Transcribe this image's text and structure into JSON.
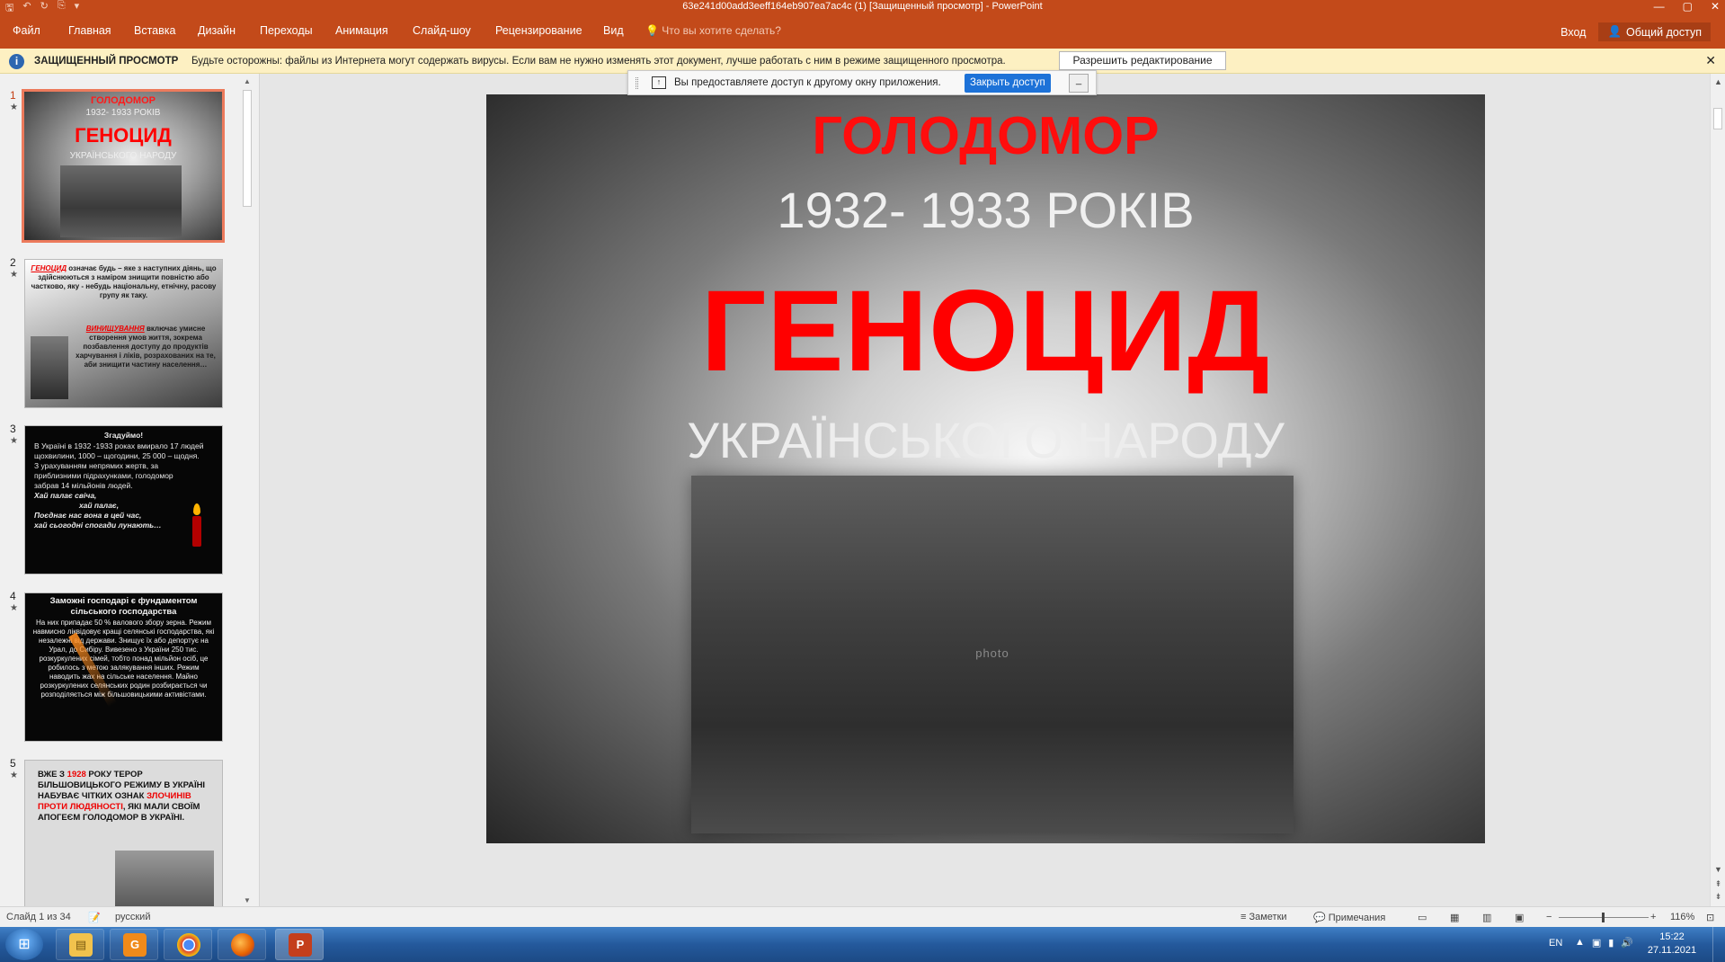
{
  "window": {
    "title": "63e241d00add3eeff164eb907ea7ac4c (1) [Защищенный просмотр] - PowerPoint",
    "controls": [
      "—",
      "▢",
      "✕"
    ]
  },
  "ribbon": {
    "tabs": [
      "Файл",
      "Главная",
      "Вставка",
      "Дизайн",
      "Переходы",
      "Анимация",
      "Слайд-шоу",
      "Рецензирование",
      "Вид"
    ],
    "tell_me": "Что вы хотите сделать?",
    "login": "Вход",
    "share": "Общий доступ"
  },
  "protected_view": {
    "title": "ЗАЩИЩЕННЫЙ ПРОСМОТР",
    "message": "Будьте осторожны: файлы из Интернета могут содержать вирусы. Если вам не нужно изменять этот документ, лучше работать с ним в режиме защищенного просмотра.",
    "enable_button": "Разрешить редактирование"
  },
  "share_notice": {
    "message": "Вы предоставляете доступ к другому окну приложения.",
    "stop_button": "Закрыть доступ",
    "minimize": "_"
  },
  "thumbnails": [
    {
      "number": "1",
      "line1": "ГОЛОДОМОР",
      "line2": "1932- 1933 РОКІВ",
      "line3": "ГЕНОЦИД",
      "line4": "УКРАЇНСЬКОГО НАРОДУ"
    },
    {
      "number": "2",
      "p1_red": "ГЕНОЦИД",
      "p1_rest": " означає будь – яке з наступних діянь, що здійснюються з наміром знищити повністю або частково, яку - небудь національну, етнічну, расову групу як таку.",
      "p2_red": "ВИНИЩУВАННЯ",
      "p2_rest": " включає умисне створення умов життя, зокрема позбавлення доступу до продуктів харчування і ліків, розрахованих на те, аби знищити частину населення…"
    },
    {
      "number": "3",
      "heading": "Згадуймо!",
      "p1": "В Україні в 1932 -1933 роках вмирало 17 людей щохвилини, 1000 – щогодини, 25 000 – щодня.",
      "p2": "З урахуванням непрямих жертв, за приблизними підрахунками, голодомор забрав 14 мільйонів людей.",
      "v1": "Хай палає свіча,",
      "v2": "хай палає,",
      "v3": "Поєднає нас вона в цей час,",
      "v4": "хай сьогодні спогади лунають…"
    },
    {
      "number": "4",
      "heading": "Заможні господарі є фундаментом сільського господарства",
      "body": "На них припадає 50 % валового збору зерна. Режим навмисно ліквідовує кращі селянські господарства, які незалежні від держави. Знищує їх або депортує на Урал, до Сибіру. Вивезено з України 250 тис. розкуркулених сімей, тобто понад мільйон осіб, це робилось з метою залякування інших. Режим наводить жах на сільське населення. Майно розкуркулених селянських родин розбирається чи розподіляється між більшовицькими активістами."
    },
    {
      "number": "5",
      "a": "ВЖЕ З ",
      "year": "1928",
      "b": " РОКУ ТЕРОР БІЛЬШОВИЦЬКОГО РЕЖИМУ В УКРАЇНІ НАБУВАЄ ЧІТКИХ ОЗНАК ",
      "red": "ЗЛОЧИНІВ ПРОТИ ЛЮДЯНОСТІ",
      "c": ", ЯКІ МАЛИ СВОЇМ АПОГЕЄМ ГОЛОДОМОР В УКРАЇНІ."
    }
  ],
  "slide": {
    "line1": "ГОЛОДОМОР",
    "line2": "1932- 1933 РОКІВ",
    "line3": "ГЕНОЦИД",
    "line4": "УКРАЇНСЬКОГО НАРОДУ",
    "photo_alt": "photo"
  },
  "statusbar": {
    "slide_info": "Слайд 1 из 34",
    "language": "русский",
    "notes": "Заметки",
    "comments": "Примечания",
    "zoom": "116%"
  },
  "taskbar": {
    "lang": "EN",
    "time": "15:22",
    "date": "27.11.2021"
  }
}
